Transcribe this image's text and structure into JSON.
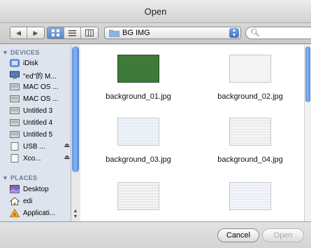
{
  "window": {
    "title": "Open"
  },
  "toolbar": {
    "nav": [
      "◀",
      "▶"
    ],
    "view_icons": [
      "icon-view-icon",
      "list-view-icon",
      "column-view-icon"
    ],
    "location": "BG IMG",
    "search_placeholder": ""
  },
  "sidebar": {
    "devices_header": "▼ DEVICES",
    "devices": [
      {
        "label": "iDisk",
        "icon": "idisk-icon",
        "eject": ""
      },
      {
        "label": "\"ed\"的 M...",
        "icon": "computer-icon",
        "eject": ""
      },
      {
        "label": "MAC OS ...",
        "icon": "disk-icon",
        "eject": ""
      },
      {
        "label": "MAC OS ...",
        "icon": "disk-icon",
        "eject": ""
      },
      {
        "label": "Untitled 3",
        "icon": "disk-icon",
        "eject": ""
      },
      {
        "label": "Untitled 4",
        "icon": "disk-icon",
        "eject": ""
      },
      {
        "label": "Untitled 5",
        "icon": "disk-icon",
        "eject": ""
      },
      {
        "label": "USB ...",
        "icon": "usb-icon",
        "eject": "⏏"
      },
      {
        "label": "Xco...",
        "icon": "disk-image-icon",
        "eject": "⏏"
      }
    ],
    "places_header": "▼ PLACES",
    "places": [
      {
        "label": "Desktop",
        "icon": "desktop-icon"
      },
      {
        "label": "edi",
        "icon": "home-icon"
      },
      {
        "label": "Applicati...",
        "icon": "applications-icon"
      }
    ]
  },
  "files": [
    {
      "name": "background_01.jpg",
      "thumb_color": "#3f7a3a"
    },
    {
      "name": "background_02.jpg",
      "thumb_color": "#f4f4f4"
    },
    {
      "name": "background_03.jpg",
      "thumb_color": "#e8eef6"
    },
    {
      "name": "background_04.jpg",
      "thumb_color": "#f0f0f0"
    },
    {
      "name": "",
      "thumb_color": "#eeeeee"
    },
    {
      "name": "",
      "thumb_color": "#eef2f7"
    }
  ],
  "buttons": {
    "cancel": "Cancel",
    "open": "Open"
  }
}
